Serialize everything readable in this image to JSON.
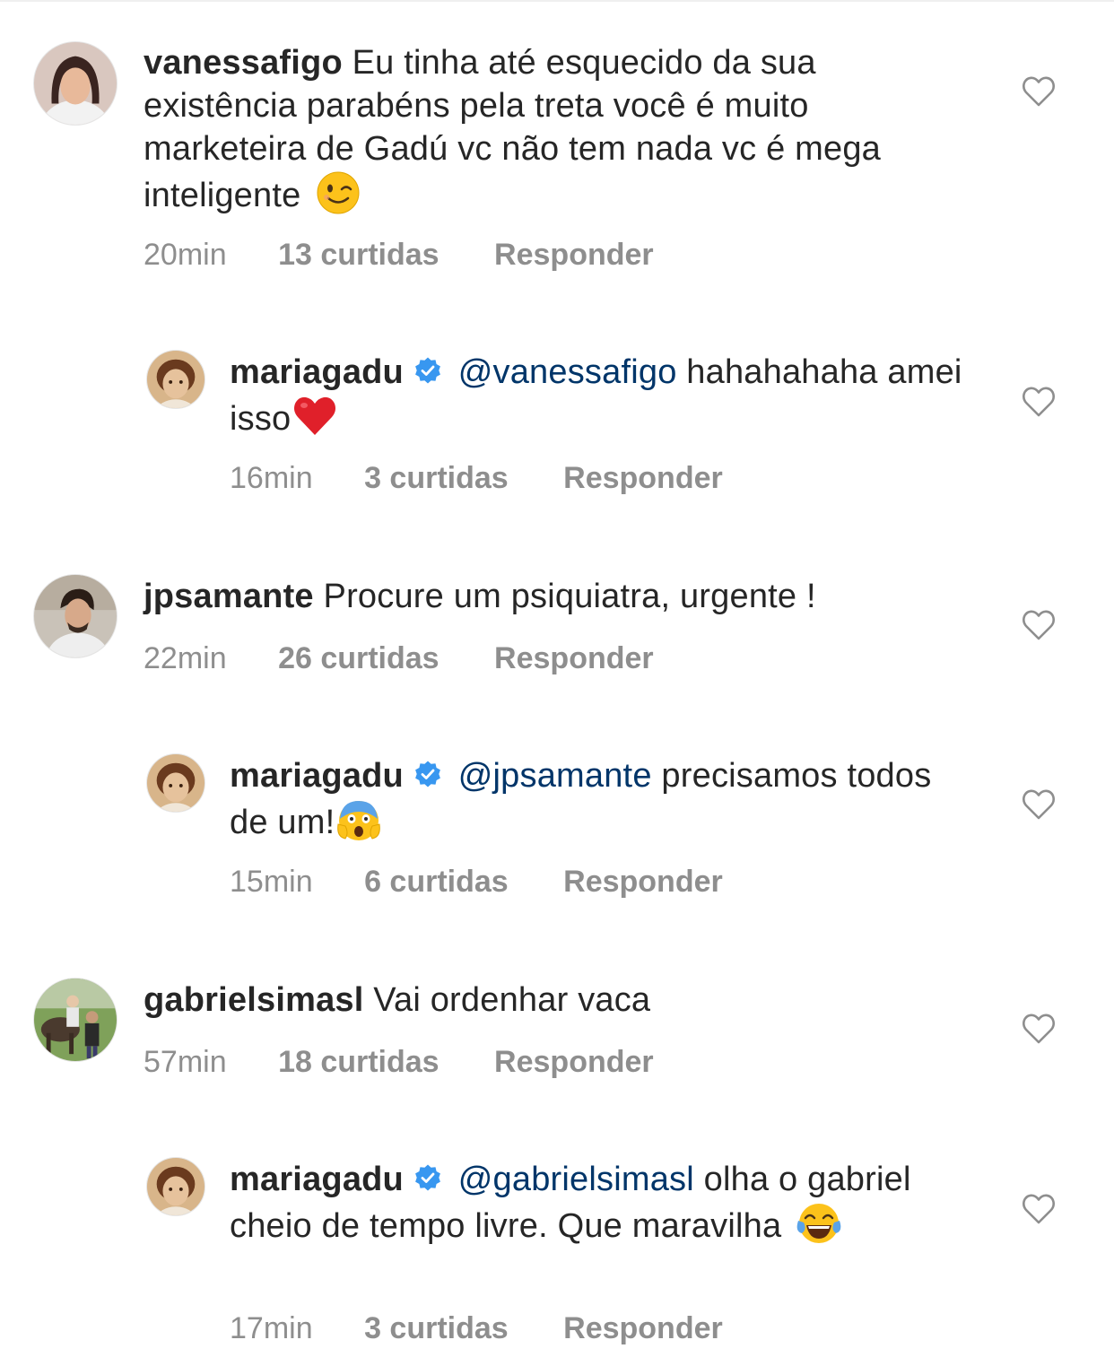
{
  "comments": [
    {
      "username": "vanessafigo",
      "text": "Eu tinha até esquecido da sua existência parabéns pela treta você é muito marketeira de Gadú vc não tem nada vc é mega inteligente",
      "time": "20min",
      "likes": "13 curtidas",
      "reply_label": "Responder",
      "emoji": "wink-emoji-icon"
    },
    {
      "username": "mariagadu",
      "mention": "@vanessafigo",
      "text": "hahahahaha amei isso",
      "time": "16min",
      "likes": "3 curtidas",
      "reply_label": "Responder",
      "emoji": "red-heart-emoji-icon"
    },
    {
      "username": "jpsamante",
      "text": "Procure um psiquiatra, urgente !",
      "time": "22min",
      "likes": "26 curtidas",
      "reply_label": "Responder"
    },
    {
      "username": "mariagadu",
      "mention": "@jpsamante",
      "text": "precisamos todos de um!",
      "time": "15min",
      "likes": "6 curtidas",
      "reply_label": "Responder",
      "emoji": "screaming-face-emoji-icon"
    },
    {
      "username": "gabrielsimasl",
      "text": "Vai ordenhar vaca",
      "time": "57min",
      "likes": "18 curtidas",
      "reply_label": "Responder"
    },
    {
      "username": "mariagadu",
      "mention": "@gabrielsimasl",
      "text": "olha o gabriel cheio de tempo livre. Que maravilha",
      "time": "17min",
      "likes": "3 curtidas",
      "reply_label": "Responder",
      "emoji": "tears-of-joy-emoji-icon"
    }
  ],
  "colors": {
    "text": "#262626",
    "meta": "#8e8e8e",
    "mention": "#003569",
    "verified": "#3897f0"
  }
}
